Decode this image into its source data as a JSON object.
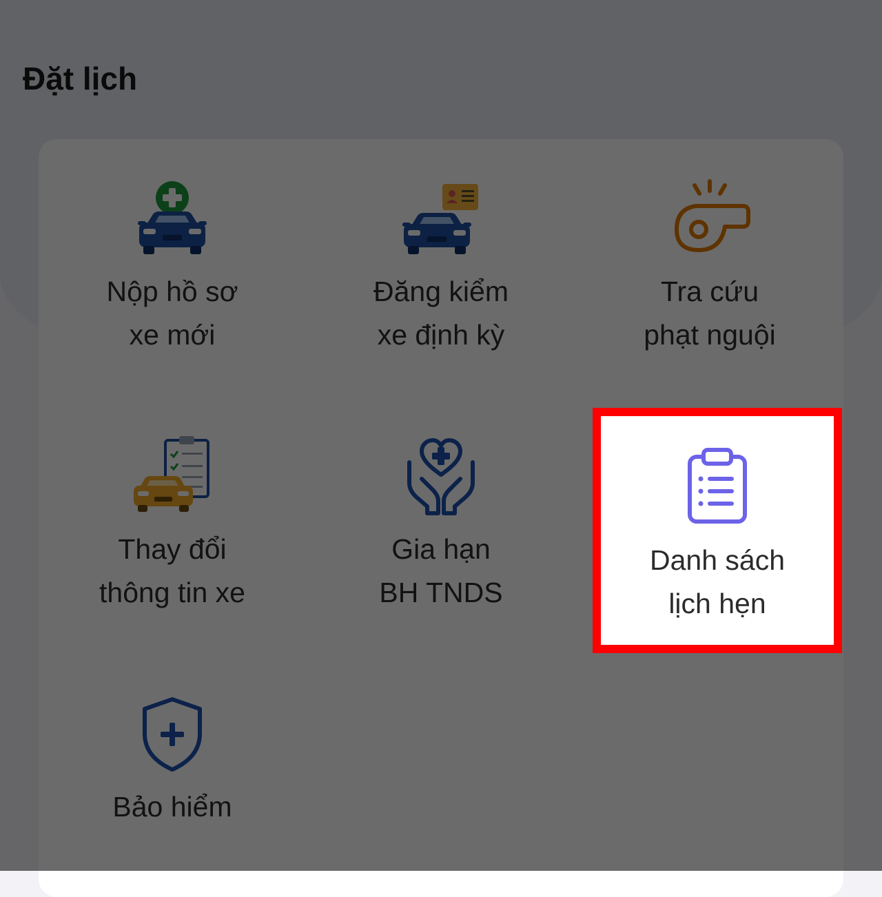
{
  "page": {
    "title": "Đặt lịch"
  },
  "services": [
    {
      "line1": "Nộp hồ sơ",
      "line2": "xe mới",
      "icon": "car-plus-icon"
    },
    {
      "line1": "Đăng kiểm",
      "line2": "xe định kỳ",
      "icon": "car-id-card-icon"
    },
    {
      "line1": "Tra cứu",
      "line2": "phạt nguội",
      "icon": "whistle-icon"
    },
    {
      "line1": "Thay đổi",
      "line2": "thông tin xe",
      "icon": "car-clipboard-icon"
    },
    {
      "line1": "Gia hạn",
      "line2": "BH TNDS",
      "icon": "heart-hands-icon"
    },
    {
      "line1": "Danh sách",
      "line2": "lịch hẹn",
      "icon": "clipboard-list-icon"
    },
    {
      "line1": "Bảo hiểm",
      "line2": "",
      "icon": "shield-plus-icon"
    }
  ],
  "highlight": {
    "target": "Danh sách lịch hẹn",
    "color": "#ff0000"
  },
  "colors": {
    "blue_car": "#1e4fa0",
    "green_plus": "#1e9a3c",
    "orange_whistle": "#e07b00",
    "yellow_car": "#f2a92a",
    "purple_clipboard": "#6c63e8",
    "shield_blue": "#1d52b0"
  }
}
